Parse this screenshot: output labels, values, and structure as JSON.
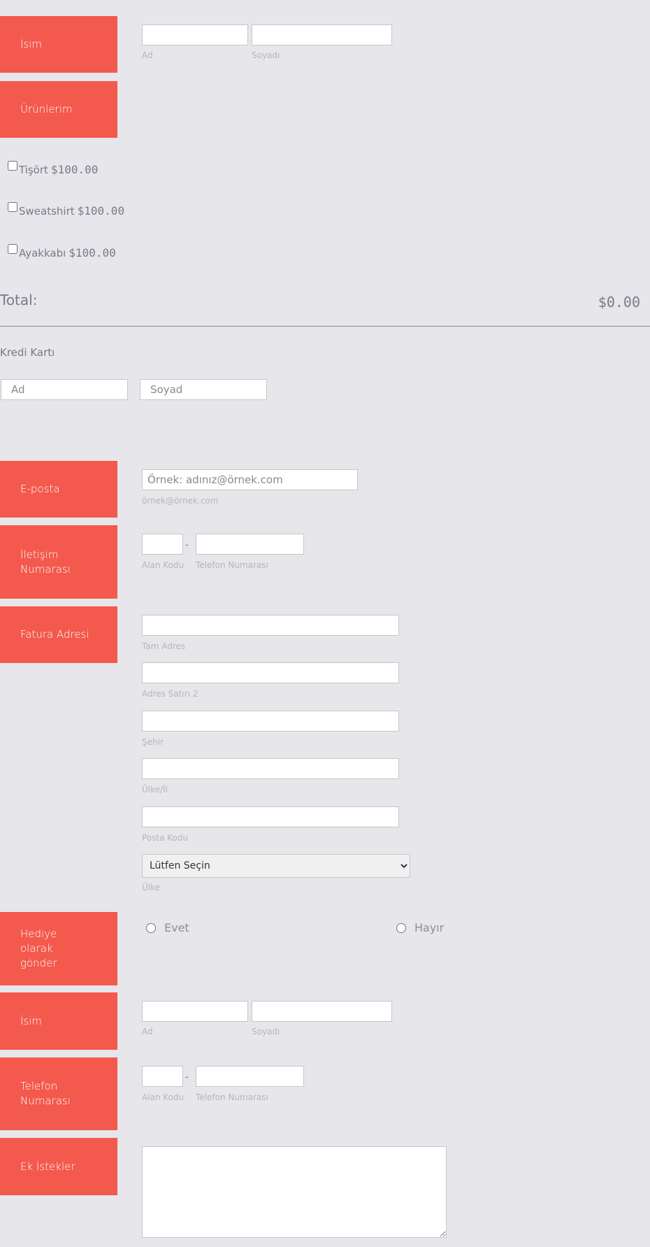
{
  "name_section": {
    "label": "İsim",
    "first_sub": "Ad",
    "last_sub": "Soyadı"
  },
  "products_section": {
    "label": "Ürünlerim",
    "items": [
      {
        "name": "Tişört",
        "price": "$100.00"
      },
      {
        "name": "Sweatshirt",
        "price": "$100.00"
      },
      {
        "name": "Ayakkabı",
        "price": "$100.00"
      }
    ],
    "total_label": "Total:",
    "total_value": "$0.00"
  },
  "credit_card": {
    "label": "Kredi Kartı",
    "first_placeholder": "Ad",
    "last_placeholder": "Soyad"
  },
  "email_section": {
    "label": "E-posta",
    "placeholder": "Örnek: adınız@örnek.com",
    "sub": "örnek@örnek.com"
  },
  "contact_section": {
    "label": "İletişim Numarası",
    "dash": "-",
    "area_sub": "Alan Kodu",
    "phone_sub": "Telefon Numarası"
  },
  "billing_section": {
    "label": "Fatura Adresi",
    "address_sub": "Tam Adres",
    "address2_sub": "Adres Satırı 2",
    "city_sub": "Şehir",
    "state_sub": "Ülke/İl",
    "zip_sub": "Posta Kodu",
    "country_selected": "Lütfen Seçin",
    "country_sub": "Ülke"
  },
  "gift_section": {
    "label": "Hediye olarak gönder",
    "yes": "Evet",
    "no": "Hayır"
  },
  "gift_name_section": {
    "label": "İsim",
    "first_sub": "Ad",
    "last_sub": "Soyadı"
  },
  "gift_phone_section": {
    "label": "Telefon Numarası",
    "dash": "-",
    "area_sub": "Alan Kodu",
    "phone_sub": "Telefon Numarası"
  },
  "extra_section": {
    "label": "Ek İstekler"
  },
  "colors": {
    "accent": "#f3594d",
    "background": "#e6e6eb"
  }
}
